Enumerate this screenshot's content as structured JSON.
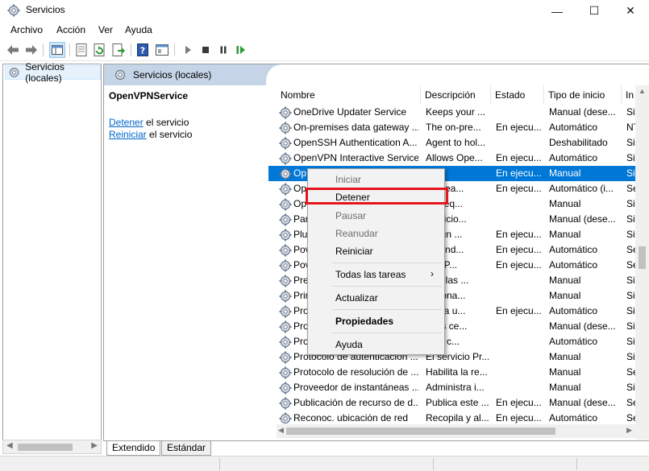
{
  "window": {
    "title": "Servicios",
    "controls": [
      "—",
      "☐",
      "✕"
    ]
  },
  "menu": [
    "Archivo",
    "Acción",
    "Ver",
    "Ayuda"
  ],
  "toolbar": [
    "back-arrow",
    "forward-arrow",
    "show-hide-console-tree",
    "properties",
    "refresh",
    "export-list",
    "help",
    "properties-sheet",
    "start-service",
    "stop-service",
    "pause-service",
    "restart-service"
  ],
  "tree": {
    "root": "Servicios (locales)"
  },
  "content_header": "Servicios (locales)",
  "desc": {
    "service_name": "OpenVPNService",
    "stop_link": "Detener",
    "stop_text": " el servicio",
    "restart_link": "Reiniciar",
    "restart_text": " el servicio"
  },
  "columns": [
    "Nombre",
    "Descripción",
    "Estado",
    "Tipo de inicio",
    "In"
  ],
  "rows": [
    {
      "name": "OneDrive Updater Service",
      "desc": "Keeps your ...",
      "state": "",
      "start": "Manual (dese...",
      "logon": "Sis"
    },
    {
      "name": "On-premises data gateway ...",
      "desc": "The on-pre...",
      "state": "En ejecu...",
      "start": "Automático",
      "logon": "NT"
    },
    {
      "name": "OpenSSH Authentication A...",
      "desc": "Agent to hol...",
      "state": "",
      "start": "Deshabilitado",
      "logon": "Sis"
    },
    {
      "name": "OpenVPN Interactive Service",
      "desc": "Allows Ope...",
      "state": "En ejecu...",
      "start": "Automático",
      "logon": "Sis"
    },
    {
      "name": "Op",
      "desc": "",
      "state": "En ejecu...",
      "start": "Manual",
      "logon": "Sis"
    },
    {
      "name": "Op",
      "desc": "a tarea...",
      "state": "En ejecu...",
      "start": "Automático (i...",
      "logon": "Se"
    },
    {
      "name": "Op",
      "desc": "a al eq...",
      "state": "",
      "start": "Manual",
      "logon": "Sis"
    },
    {
      "name": "Par",
      "desc": "servicio...",
      "state": "",
      "start": "Manual (dese...",
      "logon": "Sis"
    },
    {
      "name": "Plu",
      "desc": "lita un ...",
      "state": "En ejecu...",
      "start": "Manual",
      "logon": "Sis"
    },
    {
      "name": "Pov",
      "desc": "ground...",
      "state": "En ejecu...",
      "start": "Automático",
      "logon": "Se"
    },
    {
      "name": "Pov",
      "desc": "soft P...",
      "state": "En ejecu...",
      "start": "Automático",
      "logon": "Se"
    },
    {
      "name": "Pre",
      "desc": "arar las ...",
      "state": "",
      "start": "Manual",
      "logon": "Sis"
    },
    {
      "name": "Prin",
      "desc": "orciona...",
      "state": "",
      "start": "Manual",
      "logon": "Sis"
    },
    {
      "name": "Pro",
      "desc": "nite a u...",
      "state": "En ejecu...",
      "start": "Automático",
      "logon": "Sis"
    },
    {
      "name": "Pro",
      "desc": "a los ce...",
      "state": "",
      "start": "Manual (dese...",
      "logon": "Sis"
    },
    {
      "name": "Pro",
      "desc": "iona c...",
      "state": "",
      "start": "Automático",
      "logon": "Sis"
    },
    {
      "name": "Protocolo de autenticación ...",
      "desc": "El servicio Pr...",
      "state": "",
      "start": "Manual",
      "logon": "Sis"
    },
    {
      "name": "Protocolo de resolución de ...",
      "desc": "Habilita la re...",
      "state": "",
      "start": "Manual",
      "logon": "Se"
    },
    {
      "name": "Proveedor de instantáneas ...",
      "desc": "Administra i...",
      "state": "",
      "start": "Manual",
      "logon": "Sis"
    },
    {
      "name": "Publicación de recurso de d...",
      "desc": "Publica este ...",
      "state": "En ejecu...",
      "start": "Manual (dese...",
      "logon": "Se"
    },
    {
      "name": "Reconoc. ubicación de red",
      "desc": "Recopila y al...",
      "state": "En ejecu...",
      "start": "Automático",
      "logon": "Se"
    }
  ],
  "context_menu": {
    "start": "Iniciar",
    "stop": "Detener",
    "pause": "Pausar",
    "resume": "Reanudar",
    "restart": "Reiniciar",
    "all_tasks": "Todas las tareas",
    "refresh": "Actualizar",
    "properties": "Propiedades",
    "help": "Ayuda"
  },
  "tabs": [
    "Extendido",
    "Estándar"
  ],
  "accent_colors": {
    "selection": "#0078d7",
    "highlight_box": "#e5151c",
    "link": "#0066cc"
  }
}
